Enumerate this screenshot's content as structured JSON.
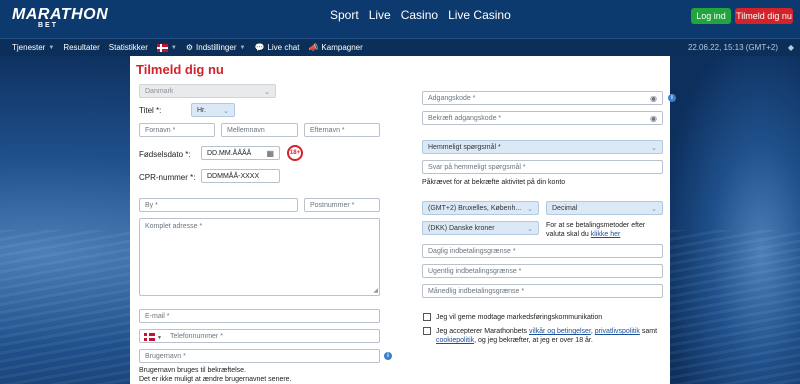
{
  "header": {
    "logo_text": "MARATHON",
    "logo_sub": "BET",
    "nav": [
      "Sport",
      "Live",
      "Casino",
      "Live Casino"
    ],
    "login_label": "Log ind",
    "register_label": "Tilmeld dig nu"
  },
  "subnav": {
    "items": [
      "Tjenester",
      "Resultater",
      "Statistikker"
    ],
    "settings_label": "Indstillinger",
    "livechat_label": "Live chat",
    "campaigns_label": "Kampagner",
    "datetime": "22.06.22, 15:13 (GMT+2)"
  },
  "form": {
    "title": "Tilmeld dig nu",
    "country_value": "Danmark",
    "title_label": "Titel *:",
    "title_value": "Hr.",
    "firstname_placeholder": "Fornavn *",
    "middlename_placeholder": "Mellemnavn",
    "lastname_placeholder": "Efternavn *",
    "dob_label": "Fødselsdato *:",
    "dob_placeholder": "DD.MM.ÅÅÅÅ",
    "age_badge": "18+",
    "cpr_label": "CPR-nummer *:",
    "cpr_placeholder": "DDMMÅÅ-XXXX",
    "city_placeholder": "By *",
    "postcode_placeholder": "Postnummer *",
    "address_placeholder": "Komplet adresse *",
    "email_placeholder": "E-mail *",
    "phone_placeholder": "Telefonnummer *",
    "username_placeholder": "Brugernavn *",
    "username_note_1": "Brugernavn bruges til bekræftelse.",
    "username_note_2": "Det er ikke muligt at ændre brugernavnet senere.",
    "password_placeholder": "Adgangskode *",
    "password_confirm_placeholder": "Bekræft adgangskode *",
    "secret_question_value": "Hemmeligt spørgsmål *",
    "secret_answer_placeholder": "Svar på hemmeligt spørgsmål *",
    "secret_note": "Påkrævet for at bekræfte aktivitet på din konto",
    "timezone_value": "(GMT+2) Bruxelles, Københ...",
    "odds_format_value": "Decimal",
    "currency_value": "(DKK) Danske kroner",
    "currency_note_1": "For at se betalingsmetoder efter",
    "currency_note_2": "valuta skal du",
    "currency_note_link": "klikke her",
    "daily_limit_placeholder": "Daglig indbetalingsgrænse *",
    "weekly_limit_placeholder": "Ugentlig indbetalingsgrænse *",
    "monthly_limit_placeholder": "Månedlig indbetalingsgrænse *",
    "marketing_label": "Jeg vil gerne modtage markedsføringskommunikation",
    "terms_1": "Jeg accepterer Marathonbets",
    "terms_link_1": "vilkår og betingelser",
    "terms_link_2": "privatlivspolitik",
    "terms_2": "samt",
    "terms_link_3": "cookiepolitik",
    "terms_3": ", og jeg bekræfter, at jeg er over 18 år."
  },
  "colors": {
    "brand_red": "#d2232a",
    "login_green": "#22a43f",
    "header_blue": "#0d3a6e",
    "field_blue": "#dbe9f7"
  }
}
